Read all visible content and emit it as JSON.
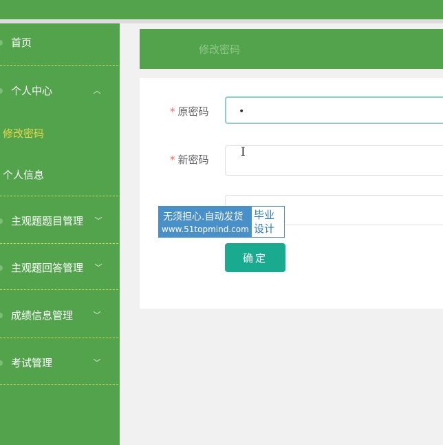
{
  "sidebar": {
    "items": [
      {
        "label": "首页"
      },
      {
        "label": "个人中心",
        "submenu": [
          {
            "label": "修改密码"
          },
          {
            "label": "个人信息"
          }
        ]
      },
      {
        "label": "主观题题目管理"
      },
      {
        "label": "主观题回答管理"
      },
      {
        "label": "成绩信息管理"
      },
      {
        "label": "考试管理"
      }
    ]
  },
  "main": {
    "header_title": "修改密码",
    "form": {
      "old_password_label": "原密码",
      "old_password_value": "•",
      "new_password_label": "新密码",
      "required_mark": "*",
      "confirm_button": "确定"
    }
  },
  "watermark": {
    "line1": "无须担心.自动发货",
    "line2": "www.51topmind.com",
    "side": "毕业设计"
  },
  "colors": {
    "sidebar_bg": "#53a34d",
    "active_menu_text": "#e6d94a",
    "button_bg": "#1aaa8f",
    "focus_border": "#8ad0c4"
  }
}
